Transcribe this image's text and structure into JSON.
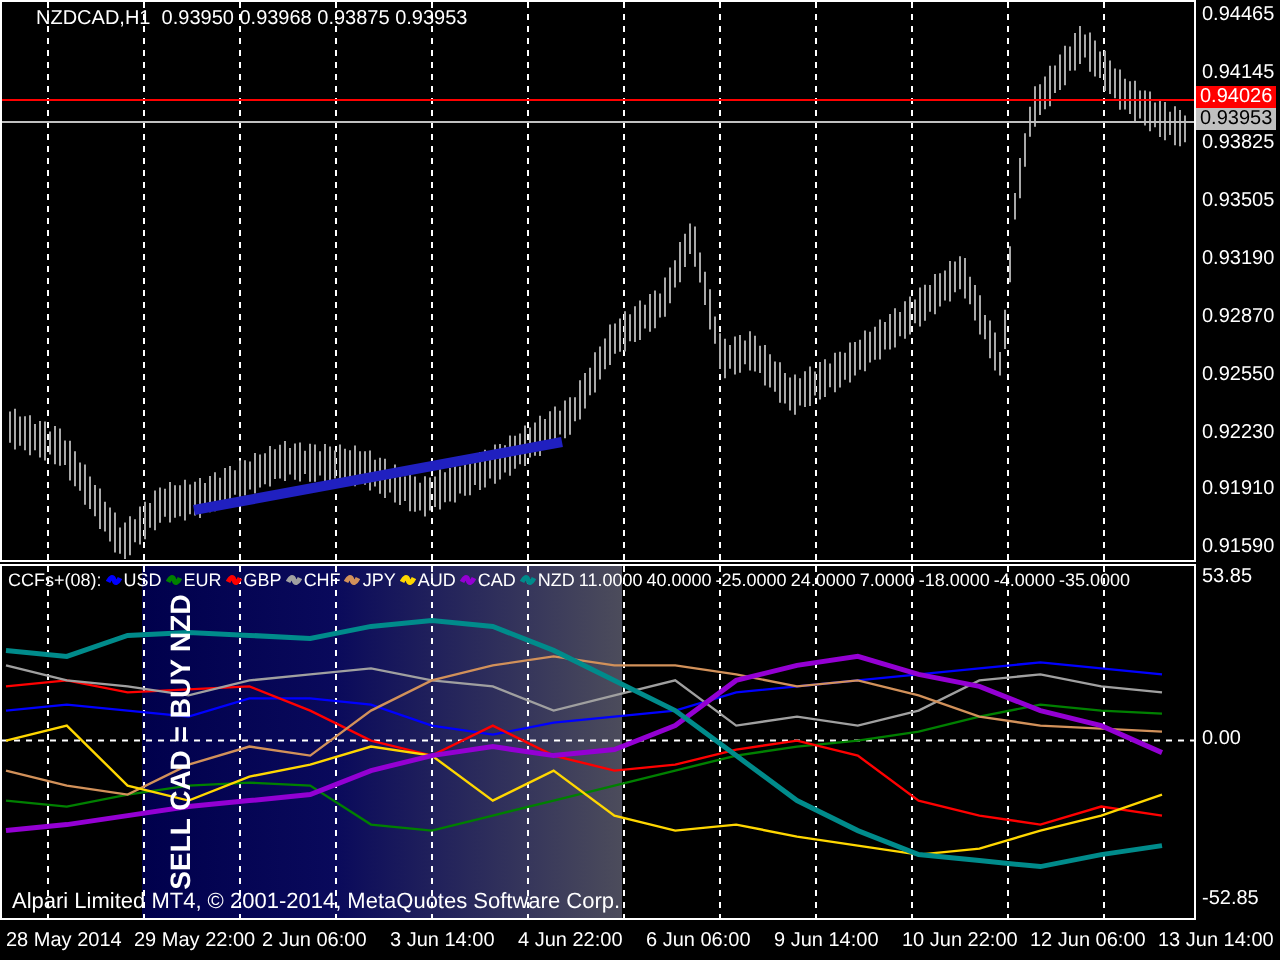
{
  "chart": {
    "symbol": "NZDCAD,H1",
    "ohlc": "0.93950 0.93968 0.93875 0.93953",
    "price_labels": [
      "0.94465",
      "0.94145",
      "0.93825",
      "0.93505",
      "0.93190",
      "0.92870",
      "0.92550",
      "0.92230",
      "0.91910",
      "0.91590"
    ],
    "lines": [
      {
        "label": "0.94026",
        "color": "#ff0000"
      },
      {
        "label": "0.93953",
        "color": "#c0c0c0"
      }
    ]
  },
  "indicator": {
    "title": "CCFs+(08):",
    "readings": [
      "11.0000",
      "40.0000",
      "-25.0000",
      "24.0000",
      "7.0000",
      "-18.0000",
      "-4.0000",
      "-35.0000"
    ],
    "signal": "SELL CAD = BUY NZD",
    "copyright": "Alpari Limited MT4, © 2001-2014, MetaQuotes Software Corp.",
    "chart_data": {
      "type": "line",
      "ylim": [
        -59.11,
        58.13
      ],
      "grid": true,
      "legend": "top-left",
      "yticks": [
        {
          "value": 53.85,
          "label": "53.85"
        },
        {
          "value": 0,
          "label": "0.00"
        },
        {
          "value": -52.85,
          "label": "-52.85"
        }
      ],
      "series": [
        {
          "name": "USD",
          "color": "#0000ff",
          "values": [
            10,
            12,
            10,
            8,
            14,
            14,
            12,
            5,
            2,
            6,
            8,
            10,
            16,
            18,
            20,
            22,
            24,
            26,
            24,
            22
          ]
        },
        {
          "name": "EUR",
          "color": "#008000",
          "values": [
            -20,
            -22,
            -18,
            -15,
            -14,
            -15,
            -28,
            -30,
            -25,
            -20,
            -15,
            -10,
            -5,
            -2,
            0,
            3,
            8,
            12,
            10,
            9
          ]
        },
        {
          "name": "GBP",
          "color": "#ff0000",
          "values": [
            18,
            20,
            16,
            17,
            18,
            10,
            0,
            -5,
            5,
            -5,
            -10,
            -8,
            -3,
            0,
            -5,
            -20,
            -25,
            -28,
            -22,
            -25
          ]
        },
        {
          "name": "CHF",
          "color": "#a0a0a0",
          "values": [
            25,
            20,
            18,
            15,
            20,
            22,
            24,
            20,
            18,
            10,
            15,
            20,
            5,
            8,
            5,
            10,
            20,
            22,
            18,
            16
          ]
        },
        {
          "name": "JPY",
          "color": "#d2915a",
          "values": [
            -10,
            -15,
            -18,
            -8,
            -2,
            -5,
            10,
            20,
            25,
            28,
            25,
            25,
            22,
            18,
            20,
            15,
            8,
            5,
            4,
            3
          ]
        },
        {
          "name": "AUD",
          "color": "#ffd700",
          "values": [
            0,
            5,
            -15,
            -20,
            -12,
            -8,
            -2,
            -5,
            -20,
            -10,
            -25,
            -30,
            -28,
            -32,
            -35,
            -38,
            -36,
            -30,
            -25,
            -18
          ]
        },
        {
          "name": "CAD",
          "color": "#9400d3",
          "values": [
            -30,
            -28,
            -25,
            -22,
            -20,
            -18,
            -10,
            -5,
            -2,
            -5,
            -3,
            5,
            20,
            25,
            28,
            22,
            18,
            10,
            5,
            -4
          ]
        },
        {
          "name": "NZD",
          "color": "#008b8b",
          "values": [
            30,
            28,
            35,
            36,
            35,
            34,
            38,
            40,
            38,
            30,
            20,
            10,
            -5,
            -20,
            -30,
            -38,
            -40,
            -42,
            -38,
            -35
          ]
        }
      ]
    }
  },
  "time_labels": [
    "28 May 2014",
    "29 May 22:00",
    "2 Jun 06:00",
    "3 Jun 14:00",
    "4 Jun 22:00",
    "6 Jun 06:00",
    "9 Jun 14:00",
    "10 Jun 22:00",
    "12 Jun 06:00",
    "13 Jun 14:00"
  ]
}
